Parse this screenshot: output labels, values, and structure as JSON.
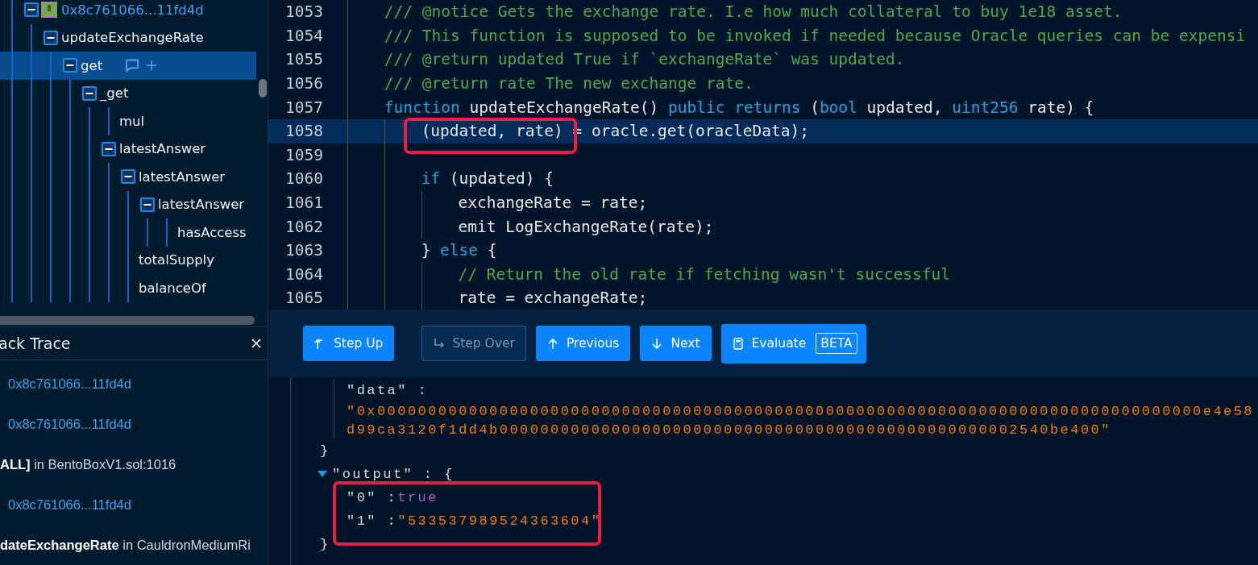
{
  "call_tree": {
    "nodes": [
      {
        "label": "0x8c761066...11fd4d",
        "kind": "address",
        "expanded": true,
        "selected": false,
        "children": [
          {
            "label": "updateExchangeRate",
            "kind": "function",
            "expanded": true,
            "selected": false,
            "children": [
              {
                "label": "get",
                "kind": "function",
                "expanded": true,
                "selected": true,
                "children": [
                  {
                    "label": "_get",
                    "kind": "function",
                    "expanded": true,
                    "selected": false,
                    "children": [
                      {
                        "label": "mul",
                        "kind": "function",
                        "selected": false
                      },
                      {
                        "label": "latestAnswer",
                        "kind": "function",
                        "expanded": true,
                        "selected": false,
                        "children": [
                          {
                            "label": "latestAnswer",
                            "kind": "function",
                            "expanded": true,
                            "selected": false,
                            "children": [
                              {
                                "label": "latestAnswer",
                                "kind": "function",
                                "expanded": true,
                                "selected": false,
                                "children": [
                                  {
                                    "label": "hasAccess",
                                    "kind": "function",
                                    "selected": false
                                  }
                                ]
                              }
                            ]
                          },
                          {
                            "label": "totalSupply",
                            "kind": "function",
                            "selected": false
                          },
                          {
                            "label": "balanceOf",
                            "kind": "function",
                            "selected": false
                          }
                        ]
                      }
                    ]
                  }
                ]
              }
            ]
          }
        ]
      }
    ]
  },
  "stack_trace": {
    "title": "ack Trace",
    "items": [
      {
        "kind": "address",
        "text": "0x8c761066...11fd4d"
      },
      {
        "kind": "address",
        "text": "0x8c761066...11fd4d"
      },
      {
        "kind": "frame",
        "text": "**ALL]** in BentoBoxV1.sol:1016"
      },
      {
        "kind": "address",
        "text": "0x8c761066...11fd4d"
      },
      {
        "kind": "frame",
        "text": "**dateExchangeRate** in CauldronMediumRi"
      }
    ]
  },
  "code": {
    "lines": [
      {
        "number": "1053",
        "selected": false,
        "tokens": [
          {
            "kind": "comment",
            "text": "/// @notice Gets the exchange rate. I.e how much collateral to buy 1e18 asset."
          }
        ]
      },
      {
        "number": "1054",
        "selected": false,
        "tokens": [
          {
            "kind": "comment",
            "text": "/// This function is supposed to be invoked if needed because Oracle queries can be expensi"
          }
        ]
      },
      {
        "number": "1055",
        "selected": false,
        "tokens": [
          {
            "kind": "comment",
            "text": "/// @return updated True if `exchangeRate` was updated."
          }
        ]
      },
      {
        "number": "1056",
        "selected": false,
        "tokens": [
          {
            "kind": "comment",
            "text": "/// @return rate The new exchange rate."
          }
        ]
      },
      {
        "number": "1057",
        "selected": false,
        "tokens": [
          {
            "kind": "keyword",
            "text": "function"
          },
          {
            "kind": "plain",
            "text": " updateExchangeRate() "
          },
          {
            "kind": "keyword",
            "text": "public returns"
          },
          {
            "kind": "plain",
            "text": " ("
          },
          {
            "kind": "keyword",
            "text": "bool"
          },
          {
            "kind": "plain",
            "text": " updated, "
          },
          {
            "kind": "keyword",
            "text": "uint256"
          },
          {
            "kind": "plain",
            "text": " rate) {"
          }
        ],
        "children": [
          {
            "number": "1058",
            "selected": true,
            "tokens": [
              {
                "kind": "plain",
                "text": "(updated, rate) = oracle.get(oracleData);"
              }
            ]
          },
          {
            "number": "1059",
            "selected": false
          },
          {
            "number": "1060",
            "selected": false,
            "tokens": [
              {
                "kind": "keyword",
                "text": "if"
              },
              {
                "kind": "plain",
                "text": " (updated) {"
              }
            ],
            "children": [
              {
                "number": "1061",
                "selected": false,
                "tokens": [
                  {
                    "kind": "plain",
                    "text": "exchangeRate = rate;"
                  }
                ]
              },
              {
                "number": "1062",
                "selected": false,
                "tokens": [
                  {
                    "kind": "plain",
                    "text": "emit LogExchangeRate(rate);"
                  }
                ]
              }
            ]
          },
          {
            "number": "1063",
            "selected": false,
            "tokens": [
              {
                "kind": "plain",
                "text": "} "
              },
              {
                "kind": "keyword",
                "text": "else"
              },
              {
                "kind": "plain",
                "text": " {"
              }
            ],
            "children": [
              {
                "number": "1064",
                "selected": false,
                "tokens": [
                  {
                    "kind": "comment",
                    "text": "// Return the old rate if fetching wasn't successful"
                  }
                ]
              },
              {
                "number": "1065",
                "selected": false,
                "tokens": [
                  {
                    "kind": "plain",
                    "text": "rate = exchangeRate;"
                  }
                ]
              }
            ]
          }
        ]
      }
    ]
  },
  "toolbar": {
    "buttons": [
      {
        "label": "Step Up",
        "disabled": false
      },
      {
        "label": "Step Over",
        "disabled": true
      },
      {
        "label": "Previous",
        "disabled": false
      },
      {
        "label": "Next",
        "disabled": false
      },
      {
        "label": "Evaluate",
        "disabled": false,
        "badge": "BETA"
      }
    ]
  },
  "json_view": {
    "items": [
      {
        "kind": "tail",
        "children": [
          {
            "kind": "string",
            "key": "\"data\" :",
            "value_lines": [
              "\"0x000000000000000000000000000000000000000000000000000000000000000000000000000000000e4e58",
              "d99ca3120f1dd4b000000000000000000000000000000000000000000000000002540be400\""
            ]
          }
        ],
        "closer": "}"
      },
      {
        "kind": "group",
        "key": "\"output\" : {",
        "expanded": true,
        "children": [
          {
            "kind": "boolean",
            "key": "\"0\" :",
            "value": "true"
          },
          {
            "kind": "string",
            "key": "\"1\" :",
            "value": "\"533537989524363604\""
          }
        ],
        "closer": "}"
      }
    ]
  }
}
